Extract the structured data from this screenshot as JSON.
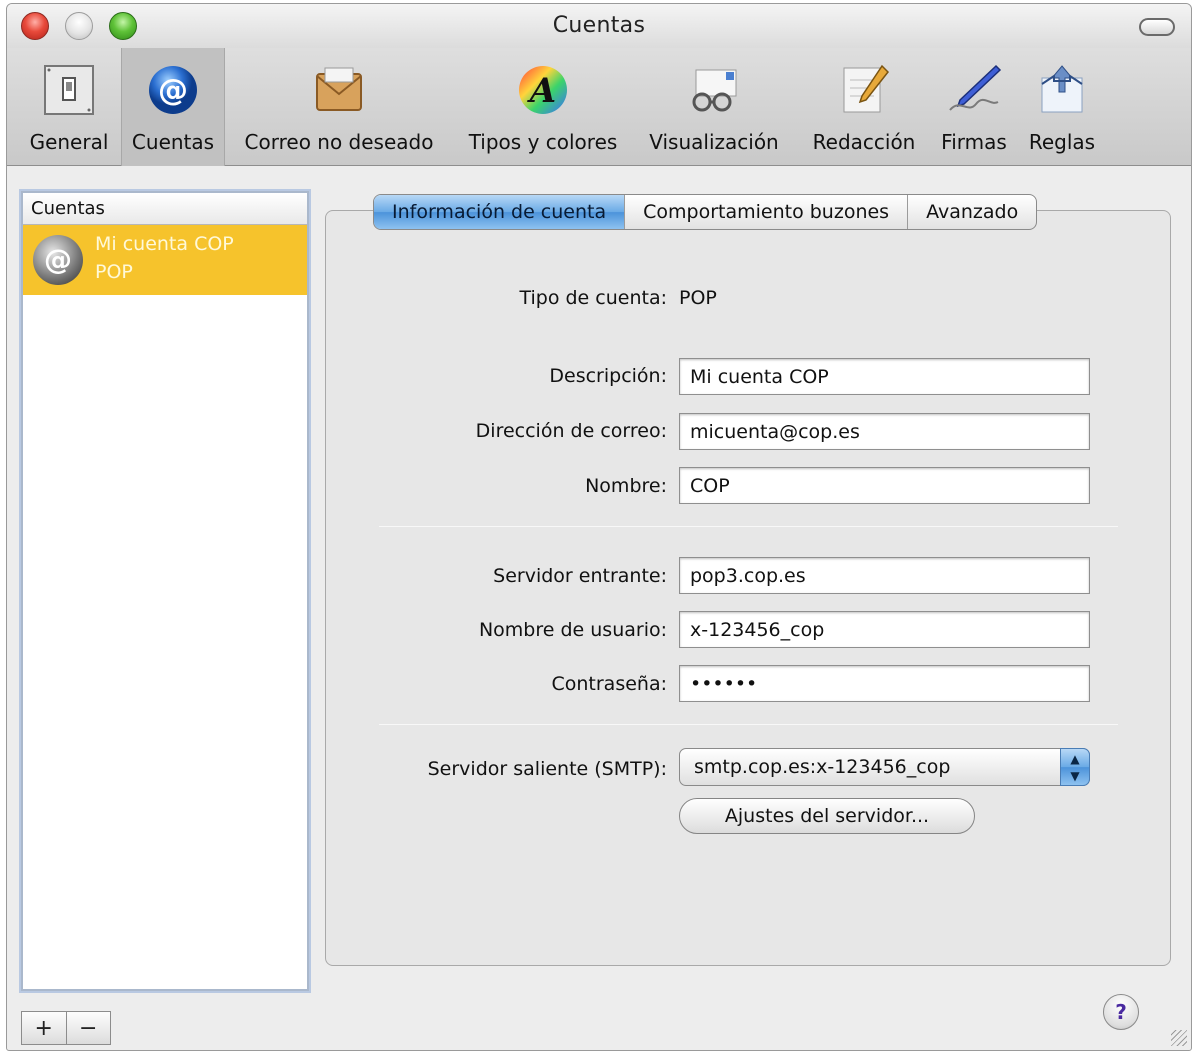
{
  "window": {
    "title": "Cuentas"
  },
  "toolbar": {
    "items": [
      {
        "label": "General",
        "icon": "light-switch-icon"
      },
      {
        "label": "Cuentas",
        "icon": "at-sign-icon"
      },
      {
        "label": "Correo no deseado",
        "icon": "junk-mail-icon"
      },
      {
        "label": "Tipos y colores",
        "icon": "fonts-colors-icon"
      },
      {
        "label": "Visualización",
        "icon": "glasses-icon"
      },
      {
        "label": "Redacción",
        "icon": "pencil-icon"
      },
      {
        "label": "Firmas",
        "icon": "pen-signature-icon"
      },
      {
        "label": "Reglas",
        "icon": "rules-arrows-icon"
      }
    ],
    "selected": "Cuentas"
  },
  "accounts": {
    "header": "Cuentas",
    "items": [
      {
        "name": "Mi cuenta COP",
        "type": "POP",
        "icon": "at-sign-icon"
      }
    ],
    "add_label": "+",
    "remove_label": "−"
  },
  "tabs": [
    {
      "label": "Información de cuenta",
      "active": true
    },
    {
      "label": "Comportamiento buzones",
      "active": false
    },
    {
      "label": "Avanzado",
      "active": false
    }
  ],
  "form": {
    "account_type_label": "Tipo de cuenta:",
    "account_type_value": "POP",
    "description_label": "Descripción:",
    "description_value": "Mi cuenta COP",
    "email_label": "Dirección de correo:",
    "email_value": "micuenta@cop.es",
    "name_label": "Nombre:",
    "name_value": "COP",
    "incoming_label": "Servidor entrante:",
    "incoming_value": "pop3.cop.es",
    "username_label": "Nombre de usuario:",
    "username_value": "x-123456_cop",
    "password_label": "Contraseña:",
    "password_value": "••••••",
    "smtp_label": "Servidor saliente (SMTP):",
    "smtp_value": "smtp.cop.es:x-123456_cop",
    "server_settings_label": "Ajustes del servidor..."
  },
  "help_label": "?",
  "colors": {
    "selection": "#f6c32c",
    "accent_blue": "#4c93da"
  }
}
